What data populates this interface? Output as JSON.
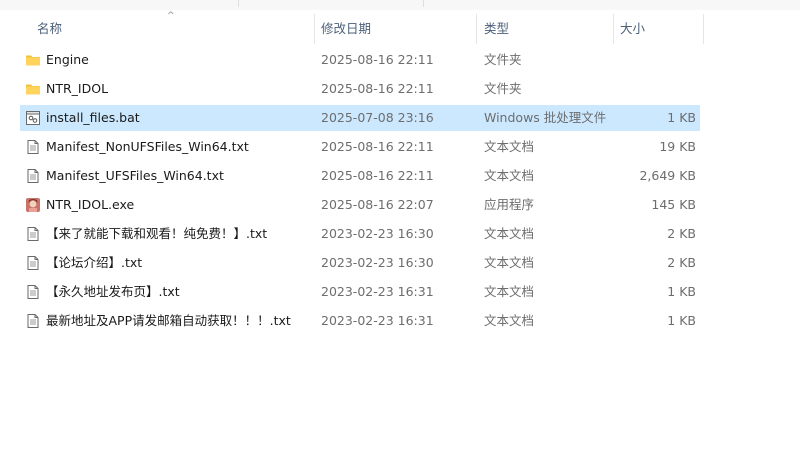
{
  "columns": {
    "name": "名称",
    "date": "修改日期",
    "type": "类型",
    "size": "大小"
  },
  "files": [
    {
      "name": "Engine",
      "date": "2025-08-16 22:11",
      "type": "文件夹",
      "size": "",
      "icon": "folder-icon"
    },
    {
      "name": "NTR_IDOL",
      "date": "2025-08-16 22:11",
      "type": "文件夹",
      "size": "",
      "icon": "folder-icon"
    },
    {
      "name": "install_files.bat",
      "date": "2025-07-08 23:16",
      "type": "Windows 批处理文件",
      "size": "1 KB",
      "icon": "batch-file-icon",
      "selected": true
    },
    {
      "name": "Manifest_NonUFSFiles_Win64.txt",
      "date": "2025-08-16 22:11",
      "type": "文本文档",
      "size": "19 KB",
      "icon": "text-file-icon"
    },
    {
      "name": "Manifest_UFSFiles_Win64.txt",
      "date": "2025-08-16 22:11",
      "type": "文本文档",
      "size": "2,649 KB",
      "icon": "text-file-icon"
    },
    {
      "name": "NTR_IDOL.exe",
      "date": "2025-08-16 22:07",
      "type": "应用程序",
      "size": "145 KB",
      "icon": "app-icon"
    },
    {
      "name": "【来了就能下载和观看！纯免费！】.txt",
      "date": "2023-02-23 16:30",
      "type": "文本文档",
      "size": "2 KB",
      "icon": "text-file-icon"
    },
    {
      "name": "【论坛介绍】.txt",
      "date": "2023-02-23 16:30",
      "type": "文本文档",
      "size": "2 KB",
      "icon": "text-file-icon"
    },
    {
      "name": "【永久地址发布页】.txt",
      "date": "2023-02-23 16:31",
      "type": "文本文档",
      "size": "1 KB",
      "icon": "text-file-icon"
    },
    {
      "name": "最新地址及APP请发邮箱自动获取！！！.txt",
      "date": "2023-02-23 16:31",
      "type": "文本文档",
      "size": "1 KB",
      "icon": "text-file-icon"
    }
  ]
}
